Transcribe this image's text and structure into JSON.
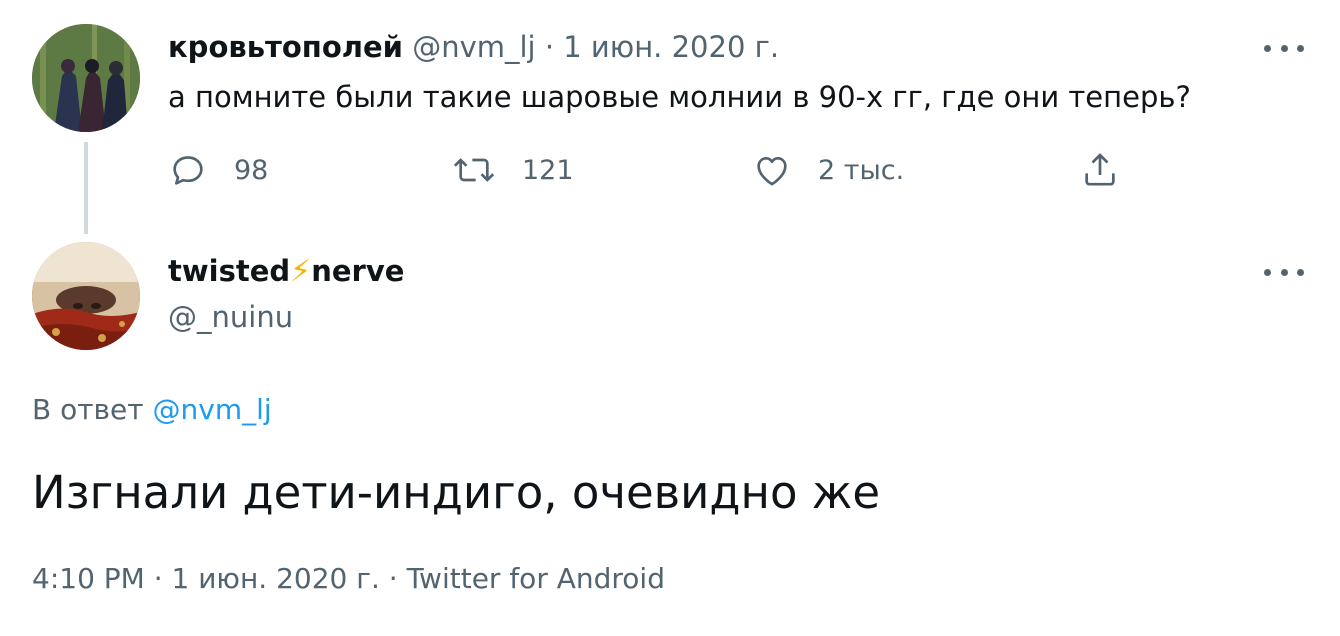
{
  "tweet1": {
    "author_name": "кровьтополей",
    "handle": "@nvm_lj",
    "separator": "·",
    "date": "1 июн. 2020 г.",
    "text": "а помните были такие шаровые молнии в 90-х гг, где они теперь?",
    "actions": {
      "replies": "98",
      "retweets": "121",
      "likes": "2 тыс."
    },
    "icons": [
      "reply-icon",
      "retweet-icon",
      "like-icon",
      "share-icon",
      "more-icon"
    ]
  },
  "tweet2": {
    "author_name_part1": "twisted",
    "author_emoji": "⚡",
    "author_name_part2": "nerve",
    "handle": "@_nuinu",
    "reply_prefix": "В ответ",
    "reply_to": "@nvm_lj",
    "text": "Изгнали дети-индиго, очевидно же",
    "meta": "4:10 PM · 1 июн. 2020 г. · Twitter for Android"
  },
  "colors": {
    "text": "#0f1419",
    "muted": "#536471",
    "link": "#1d9bf0",
    "thread_line": "#cfd9de",
    "bolt": "#f4b400"
  }
}
